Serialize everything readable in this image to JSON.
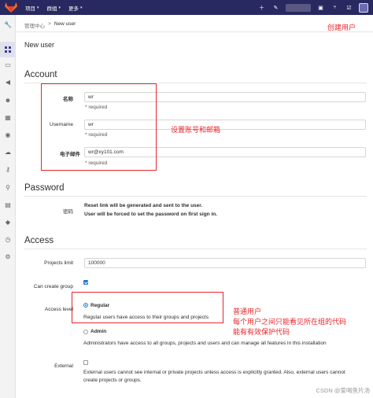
{
  "topbar": {
    "nav": [
      {
        "label": "项目"
      },
      {
        "label": "群组"
      },
      {
        "label": "更多"
      }
    ]
  },
  "breadcrumb": {
    "parent": "管理中心",
    "separator": ">",
    "current": "New user"
  },
  "page_title": "New user",
  "account": {
    "title": "Account",
    "name": {
      "label": "名称",
      "value": "wr",
      "hint": "* required"
    },
    "username": {
      "label": "Username",
      "value": "wr",
      "hint": "* required"
    },
    "email": {
      "label": "电子邮件",
      "value": "wr@xy101.com",
      "hint": "* required"
    }
  },
  "password": {
    "title": "Password",
    "label": "密码",
    "line1": "Reset link will be generated and sent to the user.",
    "line2": "User will be forced to set the password on first sign in."
  },
  "access": {
    "title": "Access",
    "projects_limit": {
      "label": "Projects limit",
      "value": "100000"
    },
    "can_create_group": {
      "label": "Can create group",
      "checked": true
    },
    "access_level": {
      "label": "Access level",
      "regular": {
        "label": "Regular",
        "desc": "Regular users have access to their groups and projects",
        "checked": true
      },
      "admin": {
        "label": "Admin",
        "desc": "Administrators have access to all groups, projects and users and can manage all features in this installation",
        "checked": false
      }
    },
    "external": {
      "label": "External",
      "checked": false,
      "line1": "External users cannot see internal or private projects unless access is explicitly granted. Also, external users cannot",
      "line2": "create projects or groups."
    }
  },
  "annotations": {
    "create_user": "创建用户",
    "set_account": "设置账号和邮箱",
    "regular_line1": "普通用户",
    "regular_line2": "每个用户之间只能看见所在组的代码",
    "regular_line3": "能有有效保护代码"
  },
  "watermark": "CSDN @爱喝鱼片汤",
  "colors": {
    "navbar": "#292961",
    "annotation": "#e8262b",
    "accent": "#1f78d1"
  }
}
